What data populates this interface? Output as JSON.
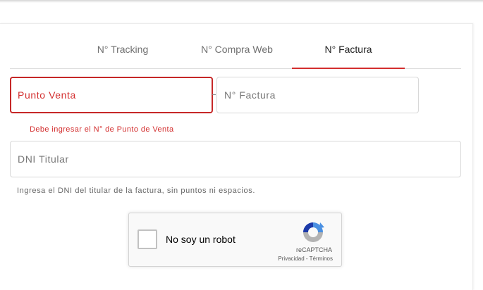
{
  "tabs": [
    {
      "label": "N° Tracking"
    },
    {
      "label": "N° Compra Web"
    },
    {
      "label": "N° Factura"
    }
  ],
  "active_tab": "N° Factura",
  "form": {
    "punto_venta": {
      "placeholder": "Punto Venta",
      "error": "Debe ingresar el N° de Punto de Venta"
    },
    "factura": {
      "placeholder": "N° Factura"
    },
    "dni": {
      "placeholder": "DNI Titular",
      "hint": "Ingresa el DNI del titular de la factura, sin puntos ni espacios."
    }
  },
  "recaptcha": {
    "label": "No soy un robot",
    "brand": "reCAPTCHA",
    "privacy": "Privacidad",
    "separator": " - ",
    "terms": "Términos"
  },
  "colors": {
    "accent": "#d32f2f",
    "active_tab_text": "#1f1f1f",
    "inactive_tab_text": "#6f6f6f"
  }
}
